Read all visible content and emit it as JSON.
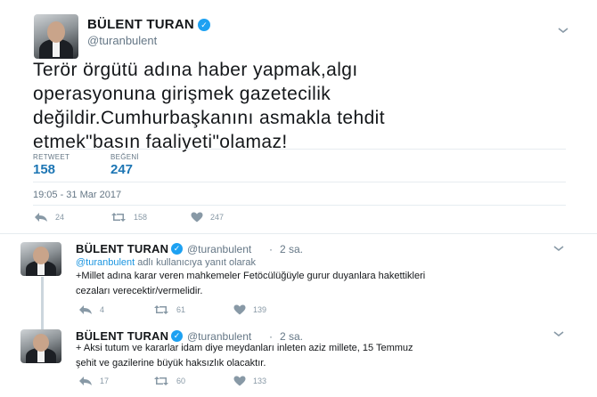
{
  "main_tweet": {
    "name": "BÜLENT TURAN",
    "handle": "@turanbulent",
    "text_lines": [
      "Terör örgütü adına haber yapmak,algı",
      "operasyonuna girişmek gazetecilik",
      "değildir.Cumhurbaşkanını asmakla tehdit",
      "etmek\"basın faaliyeti\"olamaz!"
    ],
    "stats": {
      "retweet_label": "RETWEET",
      "retweet_value": "158",
      "like_label": "BEĞENİ",
      "like_value": "247"
    },
    "datetime": "19:05 - 31 Mar 2017",
    "actions": {
      "reply": "24",
      "retweet": "158",
      "like": "247"
    }
  },
  "replies": [
    {
      "name": "BÜLENT TURAN",
      "handle": "@turanbulent",
      "sep": "·",
      "time": "2 sa.",
      "reply_to_link": "@turanbulent",
      "reply_to_text": " adlı kullanıcıya yanıt olarak",
      "text_lines": [
        "+Millet adına karar veren mahkemeler Fetöcülüğüyle gurur duyanlara hakettikleri",
        "cezaları verecektir/vermelidir."
      ],
      "actions": {
        "reply": "4",
        "retweet": "61",
        "like": "139"
      }
    },
    {
      "name": "BÜLENT TURAN",
      "handle": "@turanbulent",
      "sep": "·",
      "time": "2 sa.",
      "text_lines": [
        "+ Aksi tutum ve kararlar idam diye meydanları inleten aziz millete, 15 Temmuz",
        "şehit ve gazilerine büyük haksızlık olacaktır."
      ],
      "actions": {
        "reply": "17",
        "retweet": "60",
        "like": "133"
      }
    }
  ],
  "icons": {
    "verified": "verified-badge-icon",
    "more": "chevron-down-icon",
    "reply": "reply-icon",
    "retweet": "retweet-icon",
    "like": "heart-icon"
  },
  "colors": {
    "link": "#1b95e0",
    "stat": "#1d76b4",
    "muted": "#657786",
    "verified": "#1da1f2"
  }
}
